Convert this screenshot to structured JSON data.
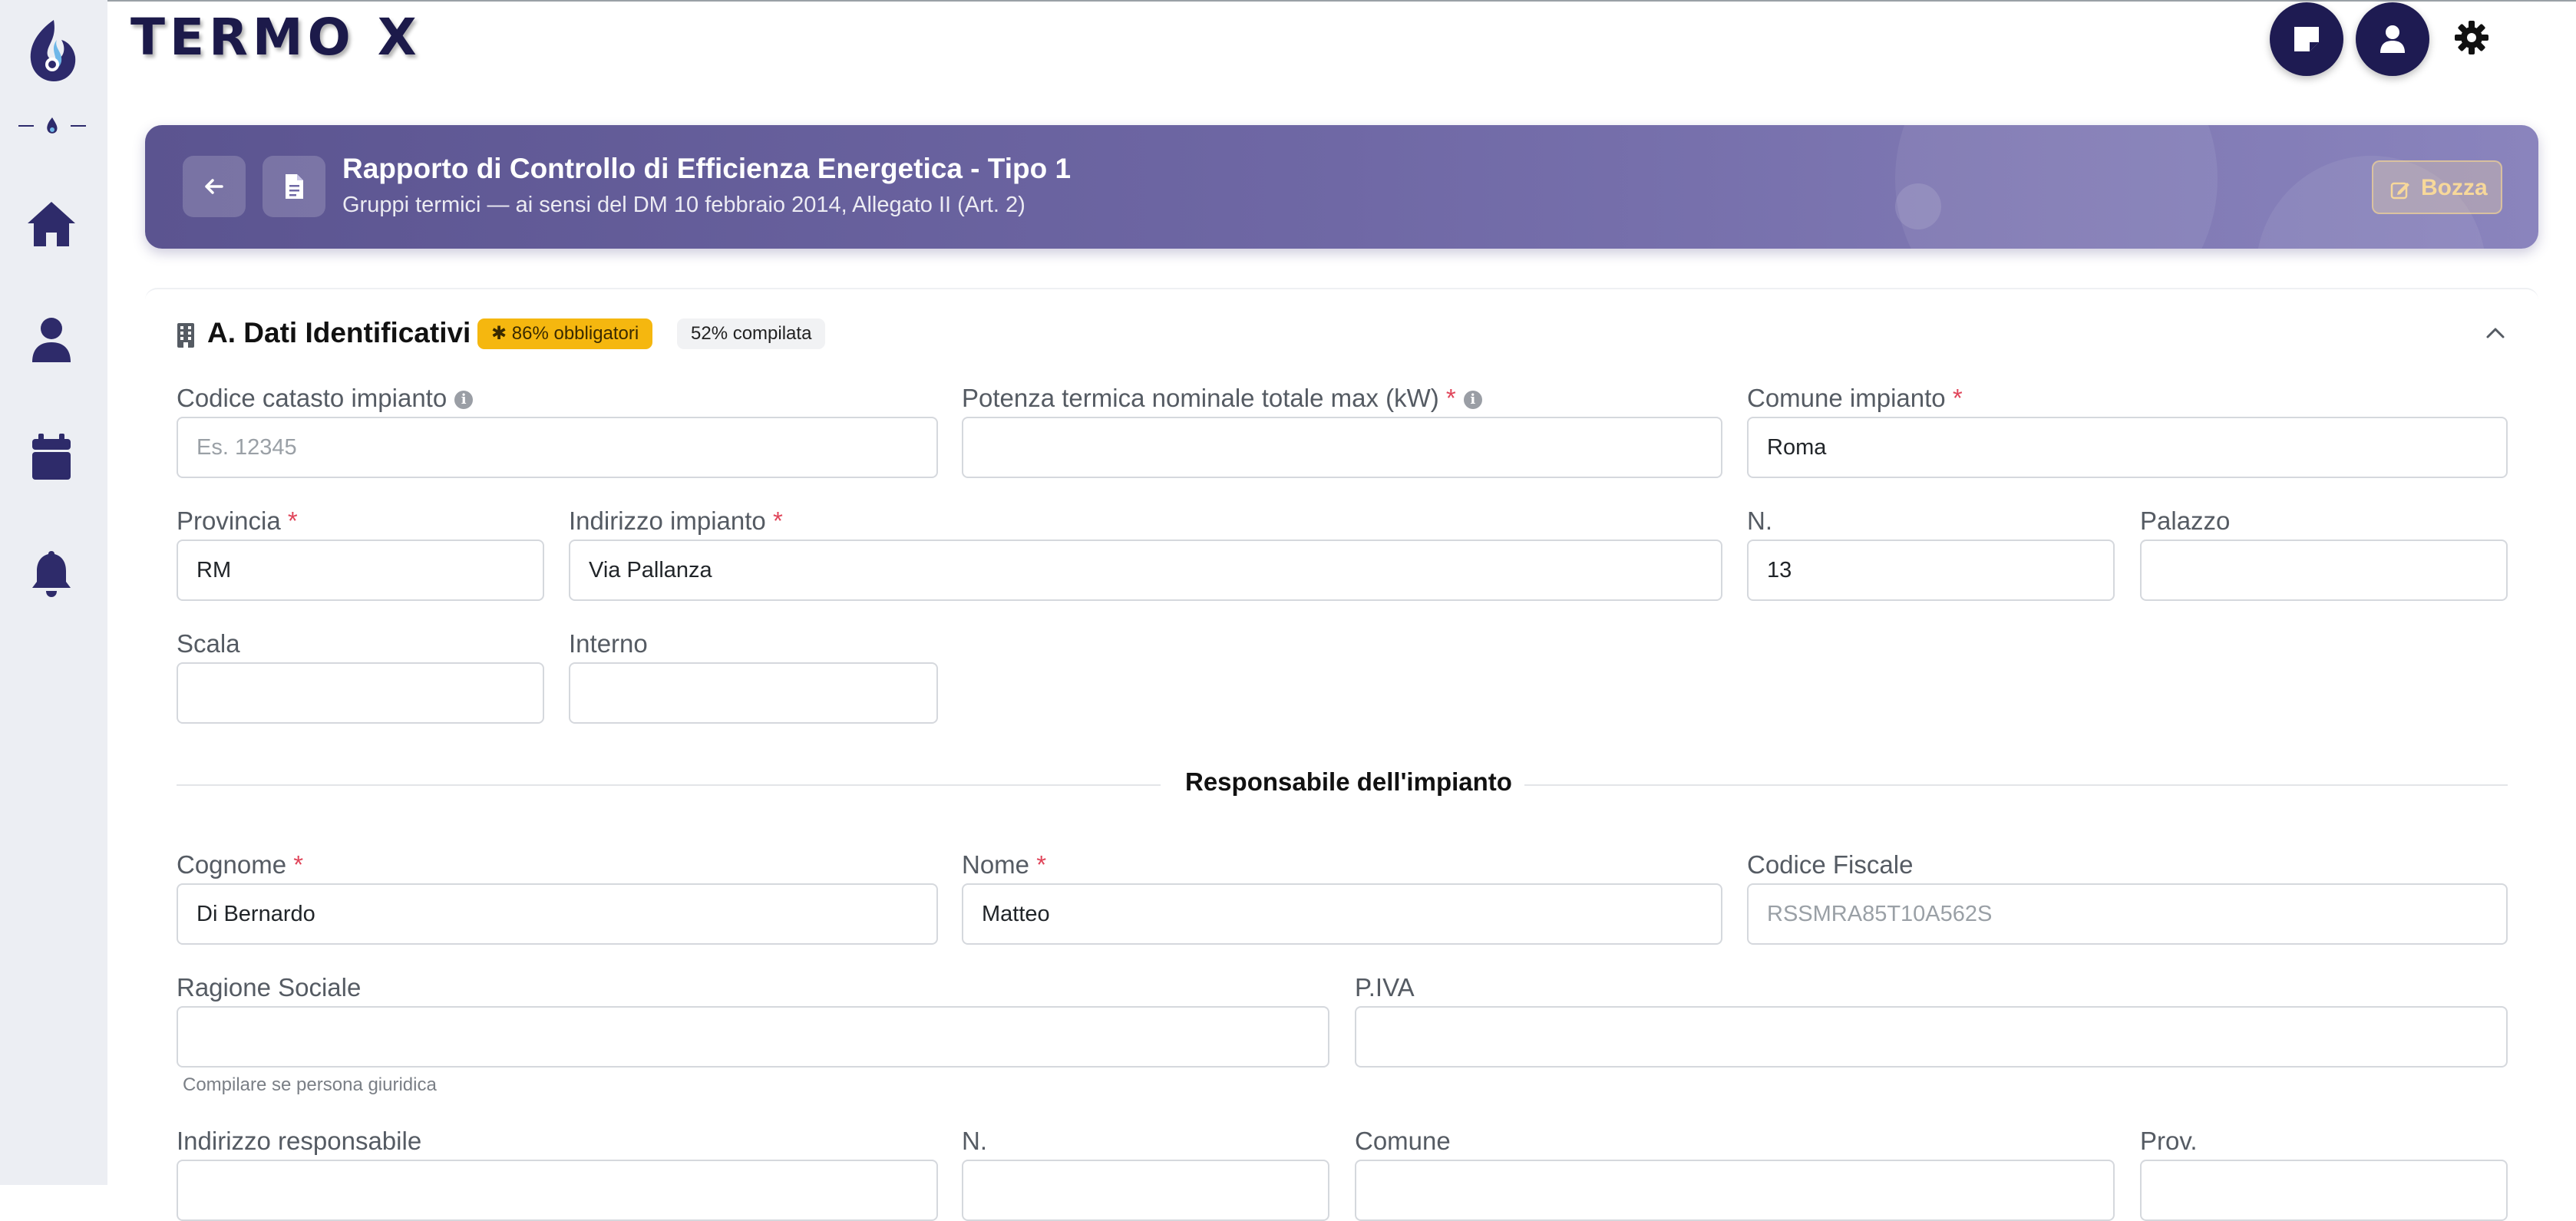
{
  "app": {
    "brand": "TERMO X"
  },
  "banner": {
    "title": "Rapporto di Controllo di Efficienza Energetica - Tipo 1",
    "subtitle": "Gruppi termici — ai sensi del DM 10 febbraio 2014, Allegato II (Art. 2)",
    "status_label": "Bozza"
  },
  "section": {
    "title": "A. Dati Identificativi",
    "required_badge": "✱ 86% obbligatori",
    "filled_badge": "52% compilata"
  },
  "fields": {
    "codice_catasto": {
      "label": "Codice catasto impianto",
      "value": "",
      "placeholder": "Es. 12345"
    },
    "potenza": {
      "label": "Potenza termica nominale totale max (kW)",
      "value": "",
      "placeholder": ""
    },
    "comune_impianto": {
      "label": "Comune impianto",
      "value": "Roma",
      "placeholder": ""
    },
    "provincia": {
      "label": "Provincia",
      "value": "RM",
      "placeholder": ""
    },
    "indirizzo_impianto": {
      "label": "Indirizzo impianto",
      "value": "Via Pallanza",
      "placeholder": ""
    },
    "numero": {
      "label": "N.",
      "value": "13",
      "placeholder": ""
    },
    "palazzo": {
      "label": "Palazzo",
      "value": "",
      "placeholder": ""
    },
    "scala": {
      "label": "Scala",
      "value": "",
      "placeholder": ""
    },
    "interno": {
      "label": "Interno",
      "value": "",
      "placeholder": ""
    }
  },
  "responsabile": {
    "title": "Responsabile dell'impianto",
    "cognome": {
      "label": "Cognome",
      "value": "Di Bernardo"
    },
    "nome": {
      "label": "Nome",
      "value": "Matteo"
    },
    "codice_fiscale": {
      "label": "Codice Fiscale",
      "value": "",
      "placeholder": "RSSMRA85T10A562S"
    },
    "ragione_sociale": {
      "label": "Ragione Sociale",
      "value": "",
      "hint": "Compilare se persona giuridica"
    },
    "piva": {
      "label": "P.IVA",
      "value": ""
    },
    "indirizzo": {
      "label": "Indirizzo responsabile"
    },
    "numero": {
      "label": "N."
    },
    "comune": {
      "label": "Comune"
    },
    "provincia": {
      "label": "Prov."
    }
  },
  "required_marker": "*",
  "info_marker": "i",
  "colors": {
    "brand": "#1e1b52",
    "banner_start": "#5b5490",
    "banner_end": "#8a84bd",
    "required_badge": "#f5b70f",
    "required_star": "#e0455a"
  }
}
